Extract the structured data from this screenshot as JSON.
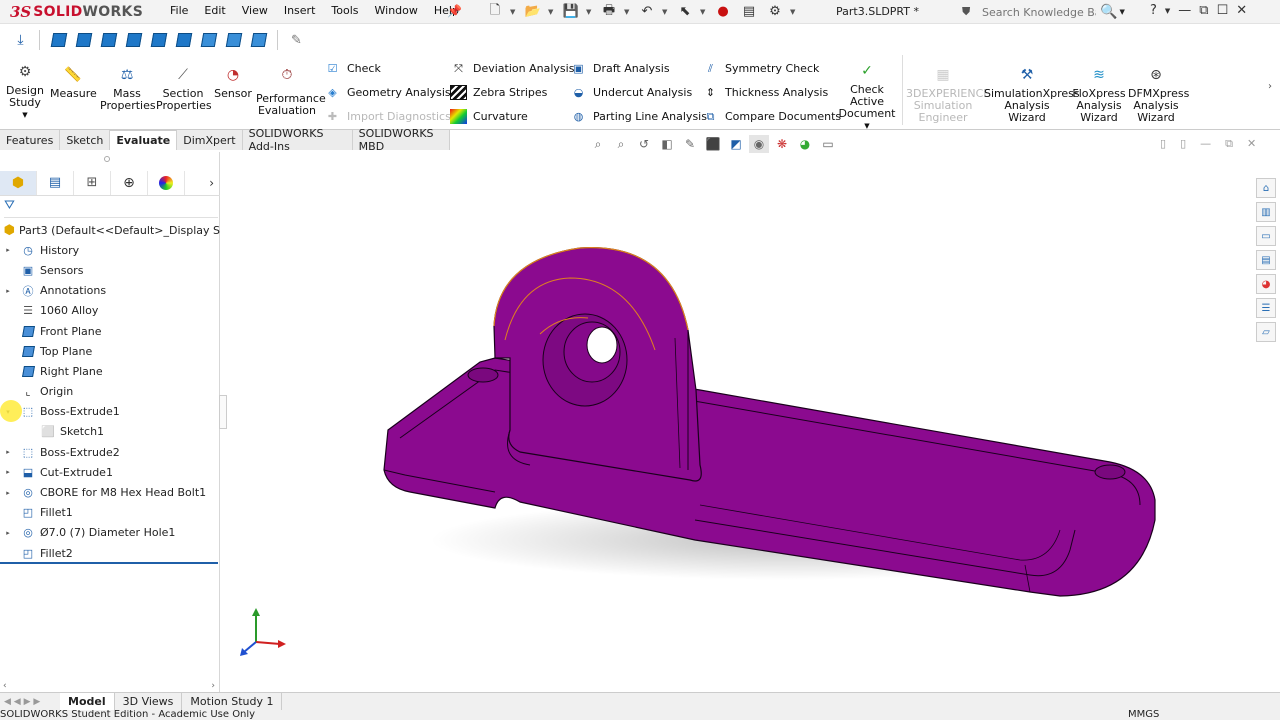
{
  "app": {
    "brand_ds": "3S",
    "brand_solid": "SOLID",
    "brand_works": "WORKS",
    "doc_title": "Part3.SLDPRT *"
  },
  "menus": [
    "File",
    "Edit",
    "View",
    "Insert",
    "Tools",
    "Window",
    "Help"
  ],
  "search": {
    "placeholder": "Search Knowledge Base"
  },
  "evaluate_buttons": {
    "design_study": "Design Study",
    "measure": "Measure",
    "mass_properties": "Mass Properties",
    "section_properties": "Section Properties",
    "sensor": "Sensor",
    "performance_evaluation": "Performance Evaluation",
    "check": "Check",
    "geometry_analysis": "Geometry Analysis",
    "import_diagnostics": "Import Diagnostics",
    "deviation_analysis": "Deviation Analysis",
    "zebra_stripes": "Zebra Stripes",
    "curvature": "Curvature",
    "draft_analysis": "Draft Analysis",
    "undercut_analysis": "Undercut Analysis",
    "parting_line_analysis": "Parting Line Analysis",
    "symmetry_check": "Symmetry Check",
    "thickness_analysis": "Thickness Analysis",
    "compare_documents": "Compare Documents",
    "check_active_document": "Check Active Document",
    "experience_simulation": "3DEXPERIENCE Simulation Engineer",
    "simulationxpress": "SimulationXpress Analysis Wizard",
    "floxpress": "FloXpress Analysis Wizard",
    "dfmxpress": "DFMXpress Analysis Wizard"
  },
  "cm_tabs": [
    "Features",
    "Sketch",
    "Evaluate",
    "DimXpert",
    "SOLIDWORKS Add-Ins",
    "SOLIDWORKS MBD"
  ],
  "active_tab": "Evaluate",
  "tree": [
    {
      "label": "Part3  (Default<<Default>_Display S",
      "icon": "part-icon",
      "arrow": ""
    },
    {
      "label": "History",
      "icon": "history-icon",
      "arrow": "▸"
    },
    {
      "label": "Sensors",
      "icon": "sensor-icon",
      "arrow": ""
    },
    {
      "label": "Annotations",
      "icon": "annotation-icon",
      "arrow": "▸"
    },
    {
      "label": "1060 Alloy",
      "icon": "material-icon",
      "arrow": ""
    },
    {
      "label": "Front Plane",
      "icon": "plane-icon",
      "arrow": ""
    },
    {
      "label": "Top Plane",
      "icon": "plane-icon",
      "arrow": ""
    },
    {
      "label": "Right Plane",
      "icon": "plane-icon",
      "arrow": ""
    },
    {
      "label": "Origin",
      "icon": "origin-icon",
      "arrow": ""
    },
    {
      "label": "Boss-Extrude1",
      "icon": "extrude-icon",
      "arrow": "▾"
    },
    {
      "label": "Sketch1",
      "icon": "sketch-icon",
      "arrow": "",
      "indent": true
    },
    {
      "label": "Boss-Extrude2",
      "icon": "extrude-icon",
      "arrow": "▸"
    },
    {
      "label": "Cut-Extrude1",
      "icon": "cut-icon",
      "arrow": "▸"
    },
    {
      "label": "CBORE for M8 Hex Head Bolt1",
      "icon": "hole-icon",
      "arrow": "▸"
    },
    {
      "label": "Fillet1",
      "icon": "fillet-icon",
      "arrow": ""
    },
    {
      "label": "Ø7.0 (7) Diameter Hole1",
      "icon": "hole-icon",
      "arrow": "▸"
    },
    {
      "label": "Fillet2",
      "icon": "fillet-icon",
      "arrow": ""
    }
  ],
  "bottom_tabs": [
    "Model",
    "3D Views",
    "Motion Study 1"
  ],
  "active_bottom_tab": "Model",
  "status": {
    "edition": "SOLIDWORKS Student Edition - Academic Use Only",
    "units": "MMGS"
  },
  "colors": {
    "part": "#8b0a8f",
    "accent": "#1f78c8",
    "brand": "#c8102e"
  }
}
